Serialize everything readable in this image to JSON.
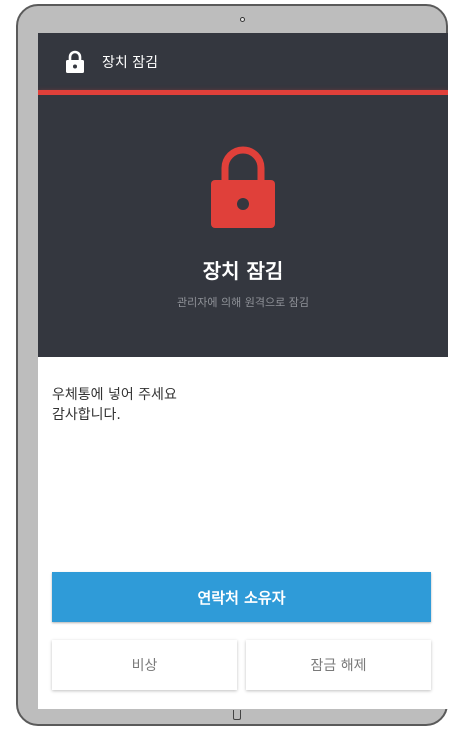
{
  "header": {
    "title": "장치 잠김"
  },
  "hero": {
    "headline": "장치 잠김",
    "subline": "관리자에 의해 원격으로 잠김"
  },
  "message": {
    "lines": [
      "우체통에 넣어 주세요",
      "감사합니다."
    ]
  },
  "buttons": {
    "contact_owner": "연락처 소유자",
    "emergency": "비상",
    "unlock": "잠금 해제"
  },
  "colors": {
    "header_bg": "#34373f",
    "accent_red": "#e0403a",
    "primary_button": "#2f9bd8"
  },
  "icons": {
    "header": "lock-icon",
    "hero": "lock-icon"
  }
}
